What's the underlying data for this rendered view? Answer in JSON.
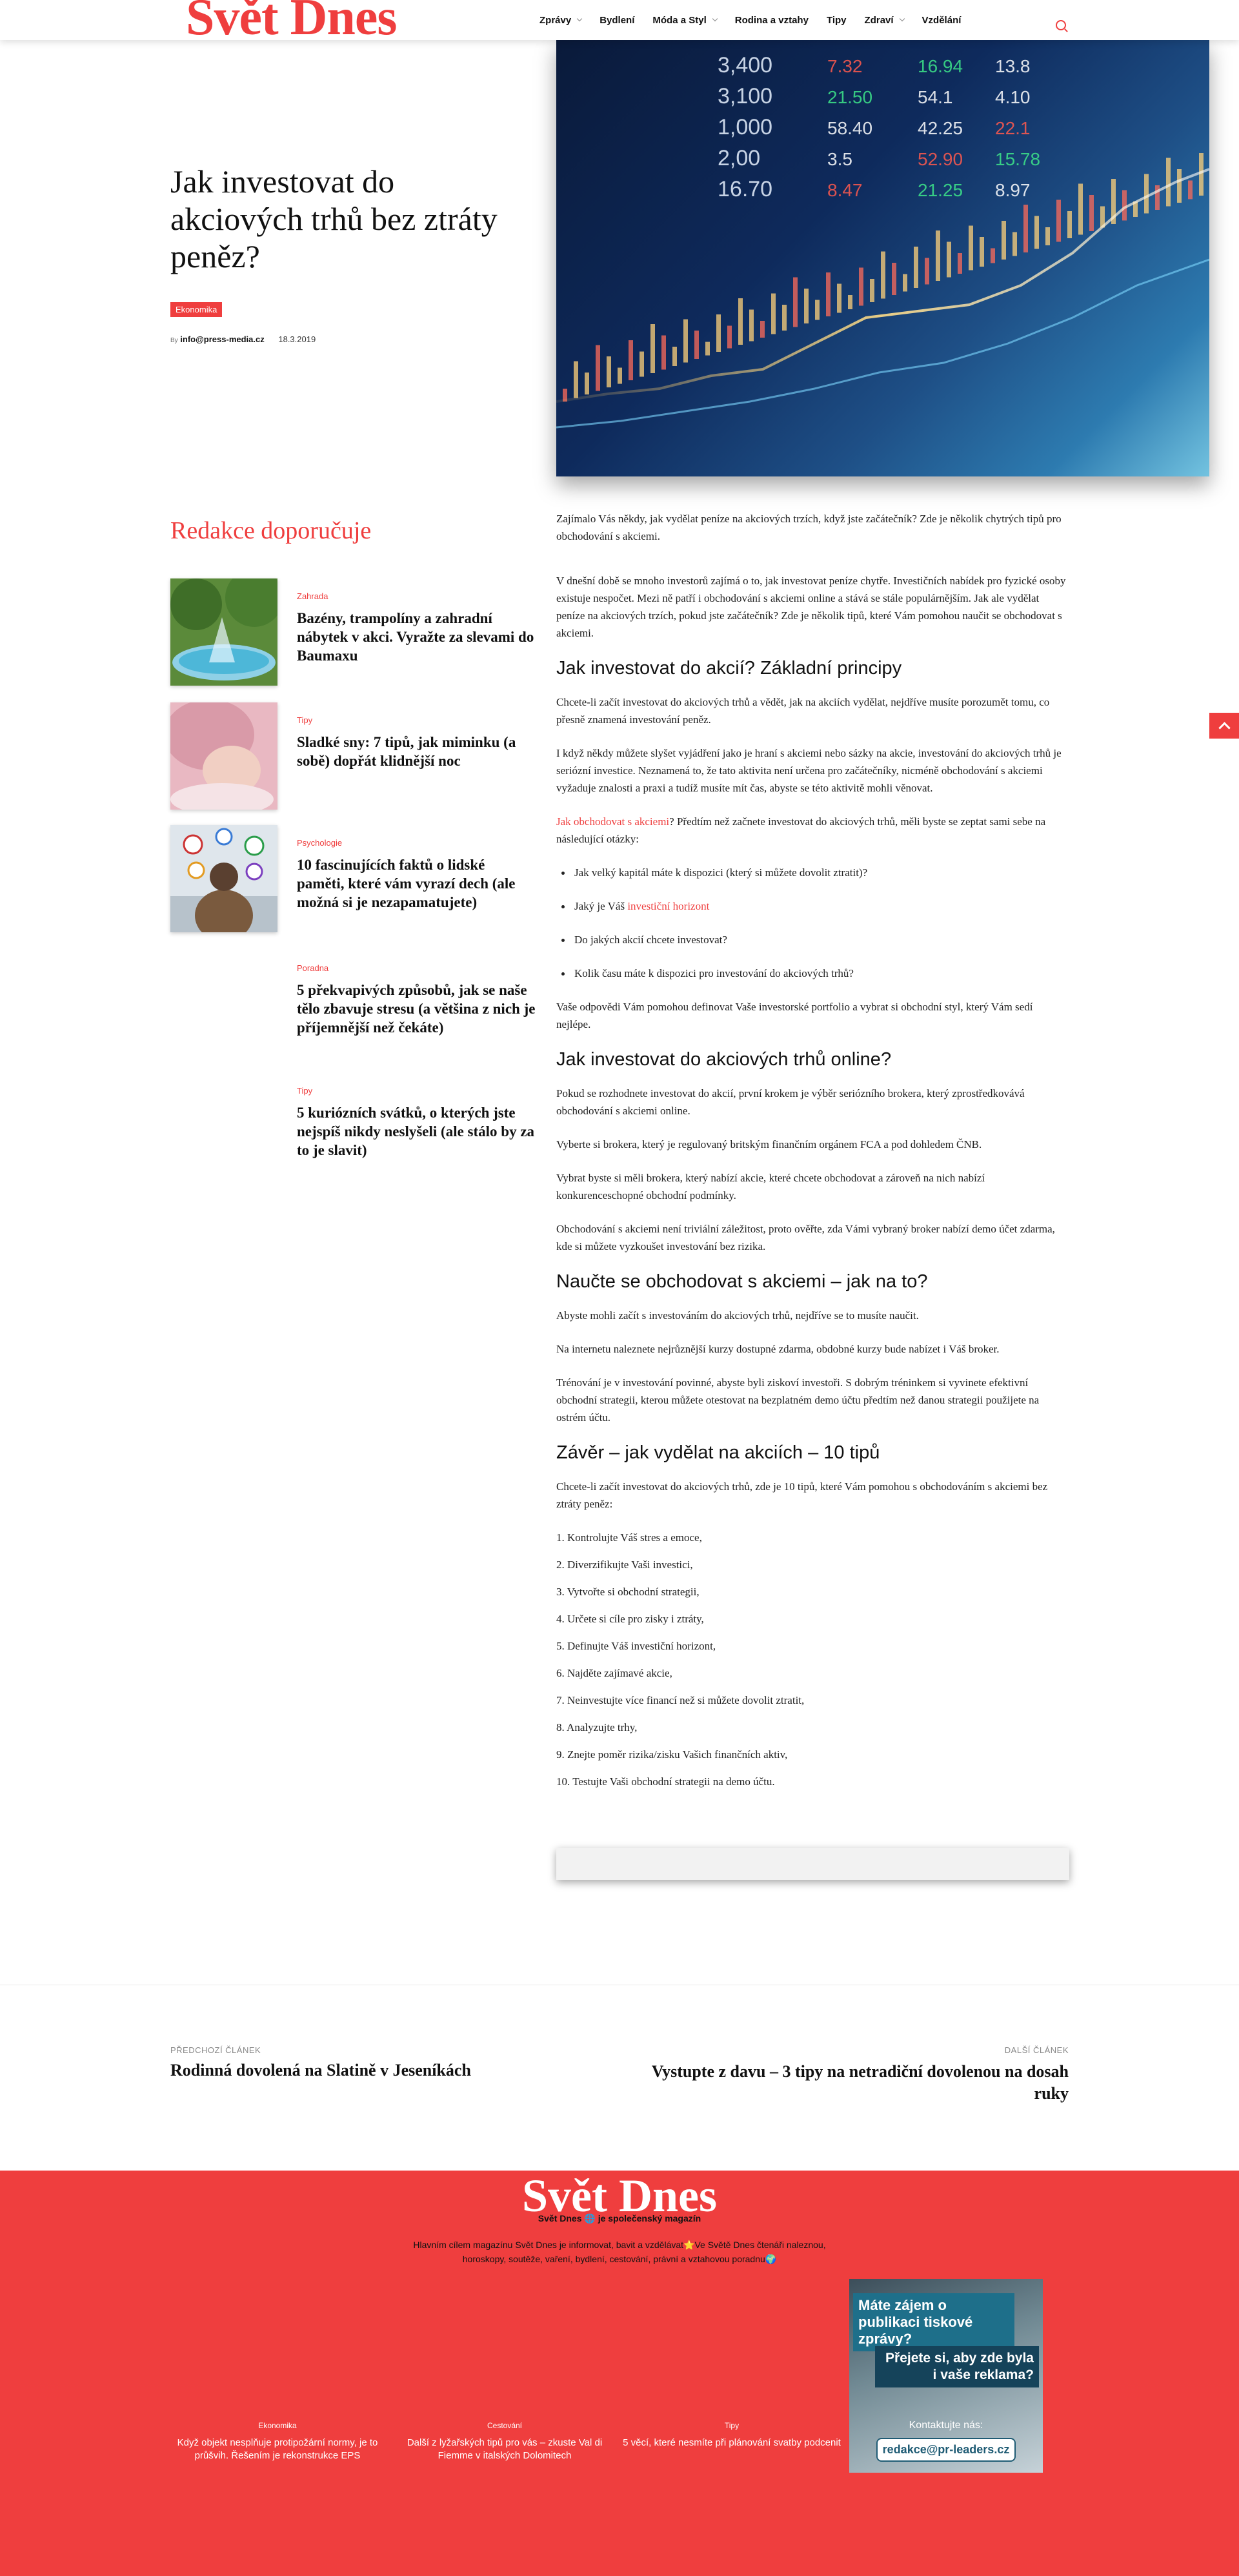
{
  "header": {
    "logo": "Svět Dnes",
    "nav": [
      {
        "label": "Zprávy",
        "has_dropdown": true
      },
      {
        "label": "Bydlení",
        "has_dropdown": false
      },
      {
        "label": "Móda a Styl",
        "has_dropdown": true
      },
      {
        "label": "Rodina a vztahy",
        "has_dropdown": false
      },
      {
        "label": "Tipy",
        "has_dropdown": false
      },
      {
        "label": "Zdraví",
        "has_dropdown": true
      },
      {
        "label": "Vzdělání",
        "has_dropdown": false
      }
    ],
    "search_icon": "search-icon"
  },
  "hero": {
    "title": "Jak investovat do akciových trhů bez ztráty peněz?",
    "category": "Ekonomika",
    "by": "By",
    "author": "info@press-media.cz",
    "date": "18.3.2019",
    "numbers": [
      "3,400",
      "3,100",
      "1,000",
      "2,00",
      "16.70",
      "7.32",
      "21.50",
      "58.40",
      "3.5",
      "8.47",
      "16.94",
      "54.1",
      "42.25",
      "52.90",
      "21.25",
      "13.8",
      "4.10",
      "22.1",
      "15.78",
      "8.97"
    ]
  },
  "sidebar": {
    "heading": "Redakce doporučuje",
    "items": [
      {
        "category": "Zahrada",
        "title": "Bazény, trampolíny a zahradní nábytek v akci. Vyražte za slevami do Baumaxu"
      },
      {
        "category": "Tipy",
        "title": "Sladké sny: 7 tipů, jak miminku (a sobě) dopřát klidnější noc"
      },
      {
        "category": "Psychologie",
        "title": "10 fascinujících faktů o lidské paměti, které vám vyrazí dech (ale možná si je nezapamatujete)"
      },
      {
        "category": "Poradna",
        "title": "5 překvapivých způsobů, jak se naše tělo zbavuje stresu (a většina z nich je příjemnější než čekáte)"
      },
      {
        "category": "Tipy",
        "title": "5 kuriózních svátků, o kterých jste nejspíš nikdy neslyšeli (ale stálo by za to je slavit)"
      }
    ]
  },
  "article": {
    "intro": "Zajímalo Vás někdy, jak vydělat peníze na akciových trzích, když jste začátečník? Zde je několik chytrých tipů pro obchodování s akciemi.",
    "p1": "V dnešní době se mnoho investorů zajímá o to, jak investovat peníze chytře. Investičních nabídek pro fyzické osoby existuje nespočet. Mezi ně patří i obchodování s akciemi online a stává se stále populárnějším. Jak ale vydělat peníze na akciových trzích, pokud jste začátečník? Zde je několik tipů, které Vám pomohou naučit se obchodovat s akciemi.",
    "h1": "Jak investovat do akcií? Základní principy",
    "p2": "Chcete-li začít investovat do akciových trhů a vědět, jak na akciích vydělat, nejdříve musíte porozumět tomu, co přesně znamená investování peněz.",
    "p3": "I když někdy můžete slyšet vyjádření jako je hraní s akciemi nebo sázky na akcie, investování do akciových trhů je seriózní investice. Neznamená to, že tato aktivita není určena pro začátečníky, nicméně obchodování s akciemi vyžaduje znalosti a praxi a tudíž musíte mít čas, abyste se této aktivitě mohli věnovat.",
    "p4_link": "Jak obchodovat s akciemi",
    "p4_rest": "? Předtím než začnete investovat do akciových trhů, měli byste se zeptat sami sebe na následující otázky:",
    "bullets": {
      "b1": "Jak velký kapitál máte k dispozici (který si můžete dovolit ztratit)?",
      "b2_pre": "Jaký je Váš ",
      "b2_link": "investiční horizont",
      "b3": "Do jakých akcií chcete investovat?",
      "b4": "Kolik času máte k dispozici pro investování do akciových trhů?"
    },
    "p5": "Vaše odpovědi Vám pomohou definovat Vaše investorské portfolio a vybrat si obchodní styl, který Vám sedí nejlépe.",
    "h2": "Jak investovat do akciových trhů online?",
    "p6": "Pokud se rozhodnete investovat do akcií, první krokem je výběr seriózního brokera, který zprostředkovává obchodování s akciemi online.",
    "p7": "Vyberte si brokera, který je regulovaný britským finančním orgánem FCA a pod dohledem ČNB.",
    "p8": "Vybrat byste si měli brokera, který nabízí akcie, které chcete obchodovat a zároveň na nich nabízí konkurenceschopné obchodní podmínky.",
    "p9": "Obchodování s akciemi není triviální záležitost, proto ověřte, zda Vámi vybraný broker nabízí demo účet zdarma, kde si můžete vyzkoušet investování bez rizika.",
    "h3": "Naučte se obchodovat s akciemi – jak na to?",
    "p10": "Abyste mohli začít s investováním do akciových trhů, nejdříve se to musíte naučit.",
    "p11": "Na internetu naleznete nejrůznější kurzy dostupné zdarma, obdobné kurzy bude nabízet i Váš broker.",
    "p12": "Trénování je v investování povinné, abyste byli ziskoví investoři. S dobrým tréninkem si vyvinete efektivní obchodní strategii, kterou můžete otestovat na bezplatném demo účtu předtím než danou strategii použijete na ostrém účtu.",
    "h4": "Závěr – jak vydělat na akciích – 10 tipů",
    "p13": "Chcete-li začít investovat do akciových trhů, zde je 10 tipů, které Vám pomohou s obchodováním s akciemi bez ztráty peněz:",
    "tips": [
      "1. Kontrolujte Váš stres a emoce,",
      "2. Diverzifikujte Vaši investici,",
      "3. Vytvořte si obchodní strategii,",
      "4. Určete si cíle pro zisky i ztráty,",
      "5. Definujte Váš investiční horizont,",
      "6. Najděte zajímavé akcie,",
      "7. Neinvestujte více financí než si můžete dovolit ztratit,",
      "8. Analyzujte trhy,",
      "9. Znejte poměr rizika/zisku Vašich finančních aktiv,",
      "10. Testujte Vaši obchodní strategii na demo účtu."
    ]
  },
  "post_nav": {
    "prev_label": "PŘEDCHOZÍ ČLÁNEK",
    "prev_title": "Rodinná dovolená na Slatině v Jeseníkách",
    "next_label": "DALŠÍ ČLÁNEK",
    "next_title": "Vystupte z davu – 3 tipy na netradiční dovolenou na dosah ruky"
  },
  "footer": {
    "logo": "Svět Dnes",
    "tagline": "Svět Dnes 🌐 je společenský magazín",
    "description": "Hlavním cílem magazínu Svět Dnes je informovat, bavit a vzdělávat⭐Ve Světě Dnes čtenáři naleznou, horoskopy, soutěže, vaření, bydlení, cestování, právní a vztahovou poradnu🌍",
    "columns": [
      {
        "category": "Ekonomika",
        "title": "Když objekt nesplňuje protipožární normy, je to průšvih. Řešením je rekonstrukce EPS"
      },
      {
        "category": "Cestování",
        "title": "Další z lyžařských tipů pro vás – zkuste Val di Fiemme v italských Dolomitech"
      },
      {
        "category": "Tipy",
        "title": "5 věcí, které nesmíte při plánování svatby podcenit"
      }
    ],
    "ad": {
      "line1": "Máte zájem o publikaci tiskové zprávy?",
      "line2": "Přejete si, aby zde byla i vaše reklama?",
      "contact": "Kontaktujte nás:",
      "email": "redakce@pr-leaders.cz"
    }
  },
  "colors": {
    "accent": "#ef3e3e",
    "text": "#111111"
  }
}
